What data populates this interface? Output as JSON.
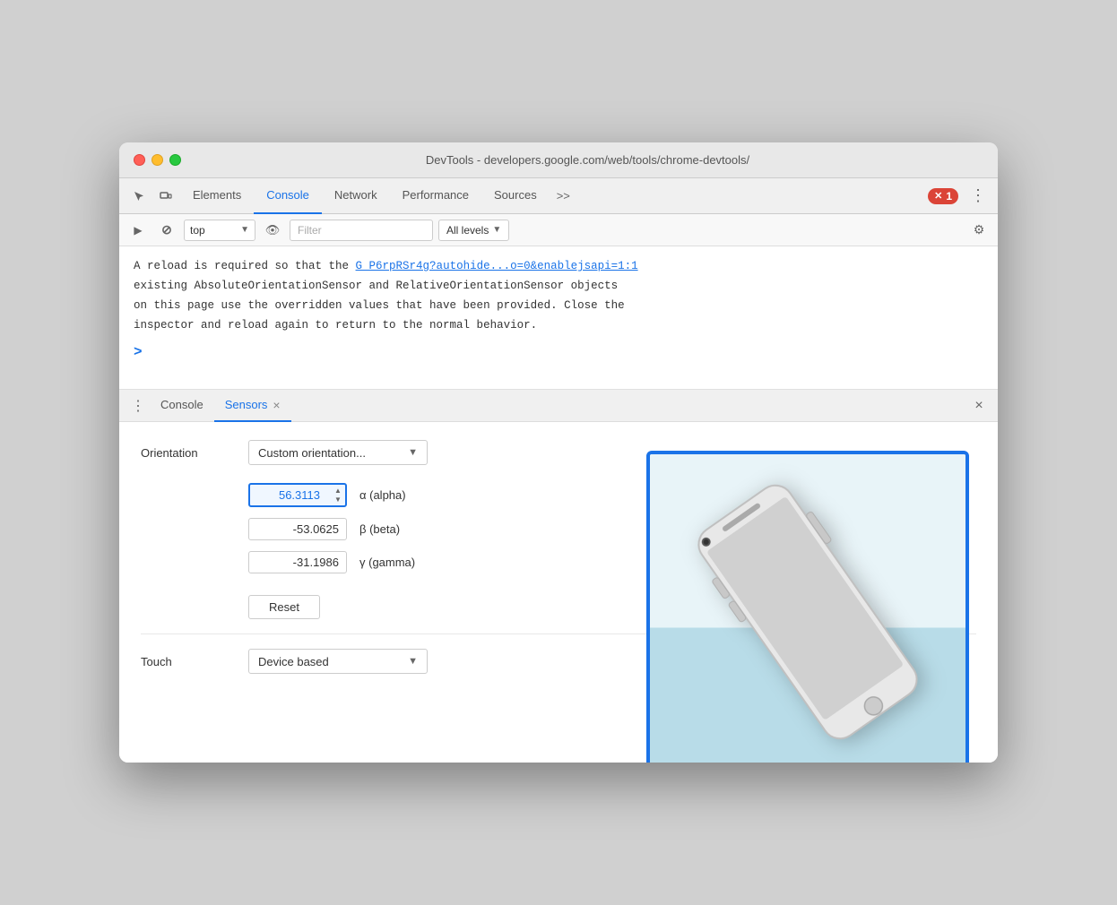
{
  "window": {
    "title": "DevTools - developers.google.com/web/tools/chrome-devtools/"
  },
  "titleBar": {
    "trafficLights": [
      "red",
      "yellow",
      "green"
    ]
  },
  "devtoolsTabs": {
    "tabs": [
      {
        "label": "Elements",
        "active": false
      },
      {
        "label": "Console",
        "active": true
      },
      {
        "label": "Network",
        "active": false
      },
      {
        "label": "Performance",
        "active": false
      },
      {
        "label": "Sources",
        "active": false
      }
    ],
    "moreLabel": ">>",
    "errorCount": "1",
    "menuIcon": "⋮"
  },
  "consoleToolbar": {
    "playIcon": "▶",
    "stopIcon": "⊘",
    "topLabel": "top",
    "arrowIcon": "▼",
    "eyeIcon": "👁",
    "filterPlaceholder": "Filter",
    "levelsLabel": "All levels",
    "levelsArrow": "▼",
    "gearIcon": "⚙"
  },
  "consoleOutput": {
    "message1": "A reload is required so that the ",
    "link1": "G_P6rpRSr4g?autohide...o=0&enablejsapi=1:1",
    "message2": "existing AbsoluteOrientationSensor and RelativeOrientationSensor objects",
    "message3": "on this page use the overridden values that have been provided. Close the",
    "message4": "inspector and reload again to return to the normal behavior.",
    "prompt": ">"
  },
  "bottomTabs": {
    "menuIcon": "⋮",
    "tabs": [
      {
        "label": "Console",
        "active": false
      },
      {
        "label": "Sensors",
        "active": true,
        "closable": true
      }
    ],
    "closeIcon": "×"
  },
  "sensorsPanel": {
    "orientationLabel": "Orientation",
    "dropdownValue": "Custom orientation...",
    "dropdownArrow": "▼",
    "alphaValue": "56.3113",
    "alphaLabel": "α (alpha)",
    "betaValue": "-53.0625",
    "betaLabel": "β (beta)",
    "gammaValue": "-31.1986",
    "gammaLabel": "γ (gamma)",
    "resetLabel": "Reset",
    "touchLabel": "Touch",
    "touchDropdownValue": "Device based",
    "touchDropdownArrow": "▼"
  }
}
